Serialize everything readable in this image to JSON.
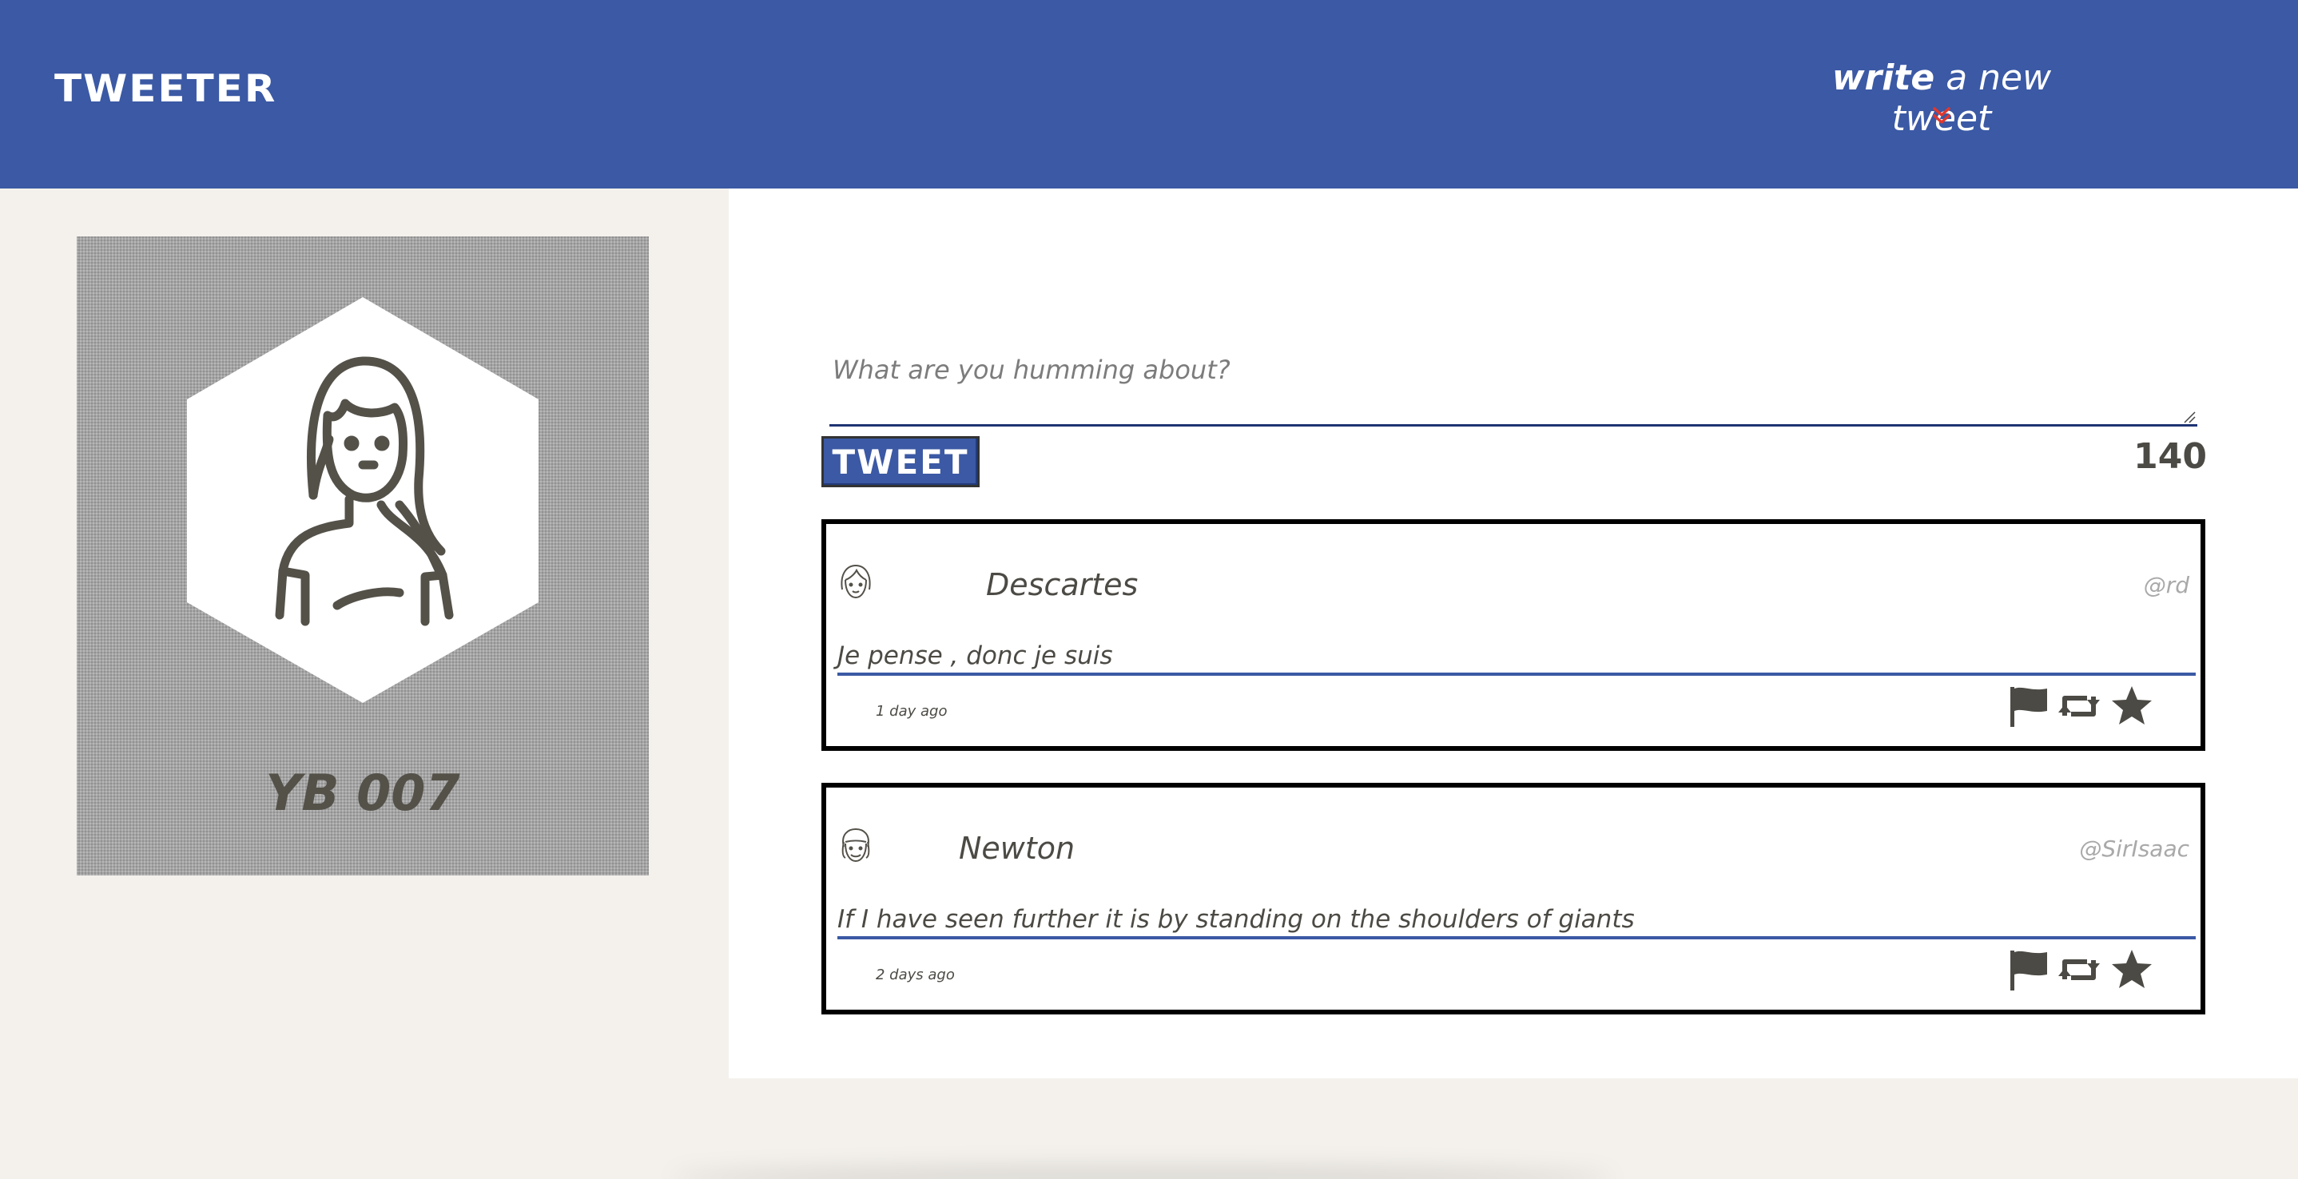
{
  "nav": {
    "brand": "TWEETER",
    "compose_bold": "write",
    "compose_rest": " a new tweet",
    "compose_icon": "double-chevron-down-icon"
  },
  "profile": {
    "name": "YB 007",
    "avatar_icon": "woman-avatar-icon"
  },
  "compose": {
    "placeholder": "What are you humming about?",
    "button_label": "TWEET",
    "counter": "140"
  },
  "tweets": [
    {
      "author": "Descartes",
      "handle": "@rd",
      "text": "Je pense , donc je suis",
      "time": "1 day ago",
      "avatar_icon": "girl-face-icon"
    },
    {
      "author": "Newton",
      "handle": "@SirIsaac",
      "text": "If I have seen further it is by standing on the shoulders of giants",
      "time": "2 days ago",
      "avatar_icon": "boy-face-icon"
    }
  ],
  "colors": {
    "nav_bg": "#3b59a4",
    "page_bg": "#f4f1ec",
    "text_dark": "#4c4a44",
    "accent_red": "#e0382d"
  }
}
